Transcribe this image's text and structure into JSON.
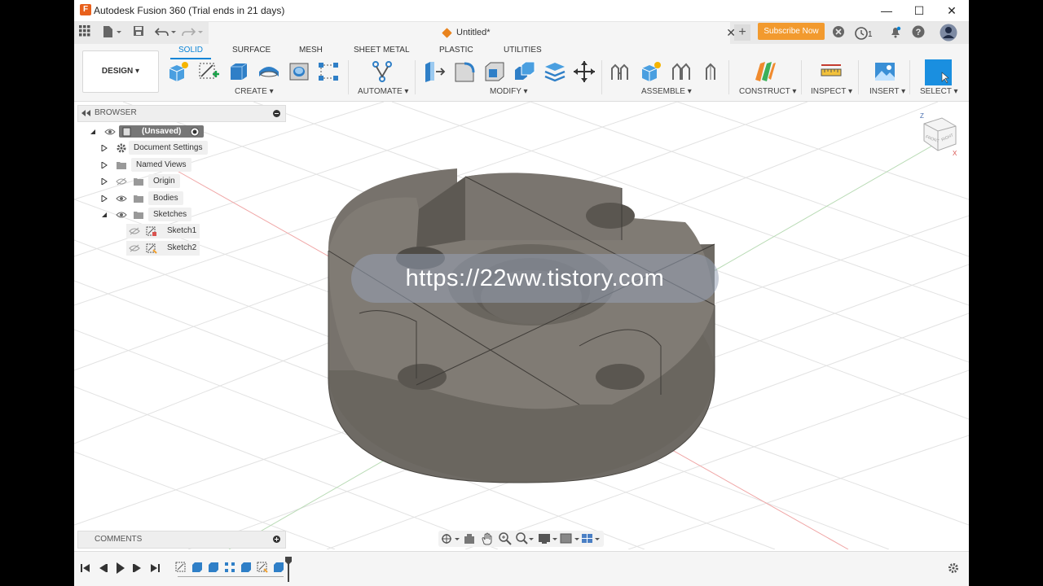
{
  "window": {
    "title": "Autodesk Fusion 360 (Trial ends in 21 days)",
    "minimize": "—",
    "maximize": "☐",
    "close": "✕"
  },
  "tabbar": {
    "doc_title": "Untitled*",
    "close": "✕",
    "add": "+",
    "subscribe": "Subscribe Now",
    "jobs_count": "1"
  },
  "toolbar": {
    "workspace": "DESIGN ▾",
    "tabs": [
      "SOLID",
      "SURFACE",
      "MESH",
      "SHEET METAL",
      "PLASTIC",
      "UTILITIES"
    ],
    "groups": [
      "CREATE ▾",
      "AUTOMATE ▾",
      "MODIFY ▾",
      "ASSEMBLE ▾",
      "CONSTRUCT ▾",
      "INSPECT ▾",
      "INSERT ▾",
      "SELECT ▾"
    ]
  },
  "browser": {
    "title": "BROWSER",
    "root": "(Unsaved)",
    "items": [
      "Document Settings",
      "Named Views",
      "Origin",
      "Bodies",
      "Sketches"
    ],
    "sketches": [
      "Sketch1",
      "Sketch2"
    ]
  },
  "comments": {
    "title": "COMMENTS"
  },
  "viewcube": {
    "top": "Z",
    "x_axis": "X",
    "front": "FRONT",
    "right": "RIGHT"
  },
  "watermark": "https://22ww.tistory.com",
  "colors": {
    "accent": "#0a84d6",
    "subscribe": "#f29a2e",
    "model": "#76716b"
  }
}
